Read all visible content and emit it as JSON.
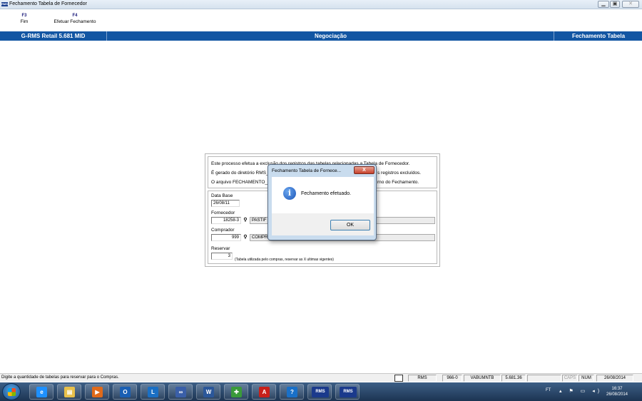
{
  "window": {
    "title": "Fechamento Tabela de Fornecedor",
    "app_icon_label": "RMS",
    "min_glyph": "▁",
    "max_glyph": "▣",
    "close_glyph": "✕"
  },
  "function_keys": [
    {
      "key": "F3",
      "label": "Fim"
    },
    {
      "key": "F4",
      "label": "Efetuar Fechamento"
    }
  ],
  "header": {
    "app": "G-RMS Retail 5.681 MID",
    "section": "Negociação",
    "screen": "Fechamento Tabela"
  },
  "info": {
    "line1": "Este processo efetua a exclusão dos registros das tabelas relacionadas a Tabela de Fornecedor.",
    "line2_start": "É gerado do diretório RMS_",
    "line2_end": "s registros excluídos.",
    "line3_start": "O arquivo FECHAMENTO_T",
    "line3_end": "rno do Fechamento."
  },
  "form": {
    "data_base_label": "Data Base",
    "data_base_value": "26/08/11",
    "fornecedor_label": "Fornecedor",
    "fornecedor_code": "18258-3",
    "fornecedor_name": "PASTIF",
    "comprador_label": "Comprador",
    "comprador_code": "999",
    "comprador_name": "COMPR",
    "reservar_label": "Reservar",
    "reservar_value": "3",
    "reservar_hint": "(Tabela utilizada pelo compras, reservar as X ultimas vigentes)"
  },
  "dialog": {
    "title": "Fechamento Tabela de Fornece...",
    "close_glyph": "X",
    "message": "Fechamento efetuado.",
    "ok_label": "OK",
    "icon_glyph": "i"
  },
  "status_bar": {
    "message": "Digite a quantidade de tabelas para reservar para o Compras.",
    "fields": [
      "RMS",
      "966-0",
      "VABUMNTB",
      "5.681.36",
      "",
      "CAPS",
      "NUM",
      "26/08/2014"
    ]
  },
  "taskbar": {
    "apps": [
      {
        "name": "internet-explorer",
        "glyph": "e",
        "color": "#1e90ff"
      },
      {
        "name": "file-explorer",
        "glyph": "▤",
        "color": "#e8c04a"
      },
      {
        "name": "media-player",
        "glyph": "▶",
        "color": "#e06a1a"
      },
      {
        "name": "outlook",
        "glyph": "O",
        "color": "#1a5fb4"
      },
      {
        "name": "lync",
        "glyph": "L",
        "color": "#1a6fc4"
      },
      {
        "name": "network-app",
        "glyph": "∞",
        "color": "#3a5fa8"
      },
      {
        "name": "word",
        "glyph": "W",
        "color": "#2b579a"
      },
      {
        "name": "installer-app",
        "glyph": "✚",
        "color": "#3a9a3a"
      },
      {
        "name": "acrobat",
        "glyph": "A",
        "color": "#c8201a"
      },
      {
        "name": "support-app",
        "glyph": "?",
        "color": "#1a70c8"
      },
      {
        "name": "rms-app-1",
        "glyph": "RMS",
        "color": "#1b3a8c"
      },
      {
        "name": "rms-app-2",
        "glyph": "RMS",
        "color": "#1b3a8c"
      }
    ],
    "tray_lang": "FT",
    "tray_icons": "▴ ⚑ ▭ ◂)",
    "time": "16:37",
    "date": "26/08/2014"
  }
}
